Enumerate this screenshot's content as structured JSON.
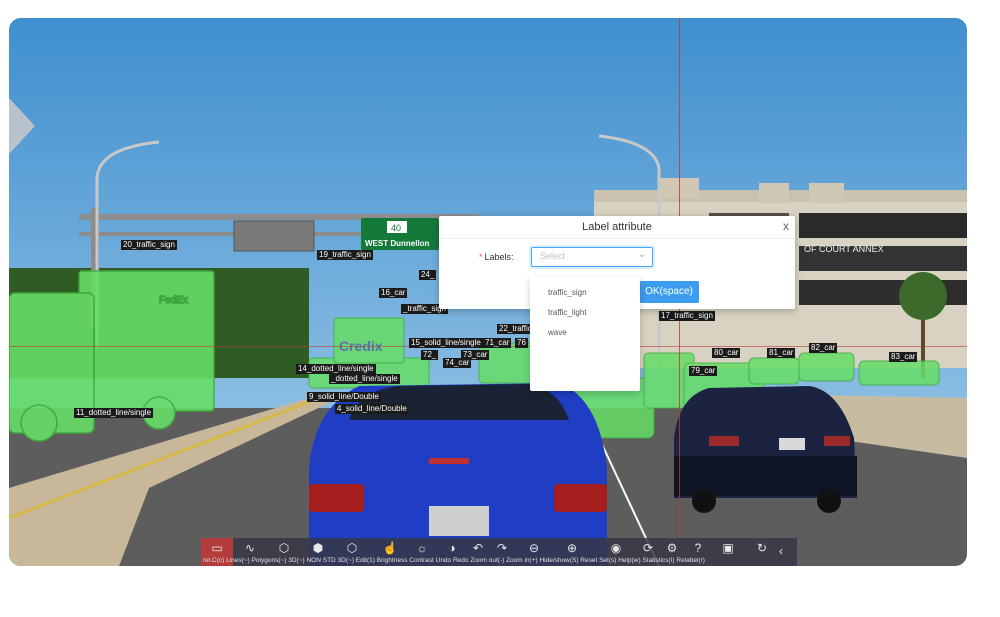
{
  "scene": {
    "sign_text": "WEST Dunnellon",
    "sign_number": "40",
    "building_text": "OF COURT ANNEX",
    "watermark": "Credix",
    "truck_text": "FedEx"
  },
  "annotation_tags": [
    "20_traffic_sign",
    "19_traffic_sign",
    "24_",
    "16_car",
    "_traffic_sign",
    "22_traffic",
    "15_solid_line/single",
    "71_car",
    "76",
    "14_dotted_line/single",
    "_dotted_line/single",
    "74_car",
    "72_",
    "73_car",
    "9_solid_line/Double",
    "4_solid_line/Double",
    "11_dotted_line/single",
    "17_traffic_sign",
    "80_car",
    "81_car",
    "82_car",
    "83_car",
    "79_car"
  ],
  "dialog": {
    "title": "Label attribute",
    "close_glyph": "x",
    "labels_required_mark": "*",
    "labels_field_label": "Labels:",
    "select_placeholder": "Select",
    "ok_button": "OK(space)",
    "options": [
      "traffic_sign",
      "traffic_light",
      "wave"
    ]
  },
  "toolbar": {
    "labels_text": "rel.C(c) Lines(~) Polygons(~) 3D(~) NON STD 3D(~) Edit(1) Brightness Contrast Undo Redo Zoom out(-) Zoom in(+) Hide/show(S) Reset Set(s) Help(w) Statistics(I) Relabel(r)",
    "icons": [
      "rectangle-icon",
      "curve-icon",
      "polygon-icon",
      "cube-icon",
      "cube-outline-icon",
      "pointer-icon",
      "brightness-icon",
      "contrast-icon",
      "undo-icon",
      "redo-icon",
      "zoom-out-icon",
      "zoom-in-icon",
      "eye-icon",
      "reset-icon",
      "settings-icon",
      "help-icon",
      "statistics-icon",
      "relabel-icon"
    ]
  },
  "colors": {
    "accent": "#3b9cf0",
    "annotation_fill": "#55e055",
    "selected_tool": "#b53c3c"
  }
}
